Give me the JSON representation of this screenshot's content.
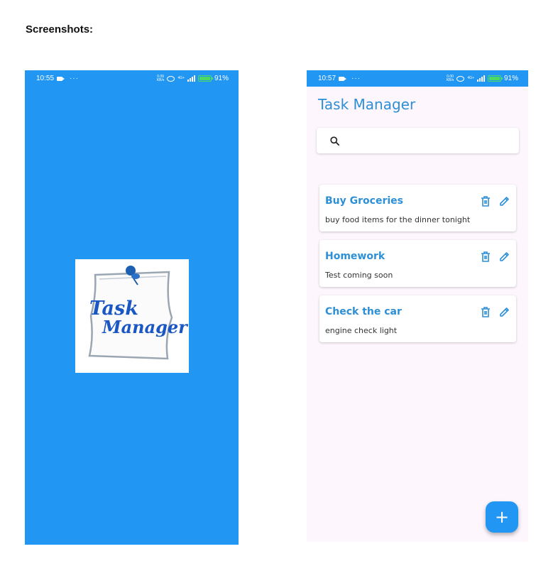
{
  "page": {
    "heading": "Screenshots:"
  },
  "splash": {
    "status": {
      "time": "10:55",
      "dots": "···",
      "speed_value": "0.09",
      "speed_unit": "KB/s",
      "network": "4G+",
      "battery": "91%"
    },
    "logo": {
      "line1": "Task",
      "line2": "Manager"
    },
    "colors": {
      "background": "#2196f3",
      "logo_text": "#1a56c4"
    }
  },
  "app": {
    "status": {
      "time": "10:57",
      "dots": "···",
      "speed_value": "0.00",
      "speed_unit": "KB/s",
      "network": "4G+",
      "battery": "91%"
    },
    "title": "Task Manager",
    "search": {
      "placeholder": "",
      "value": "",
      "icon": "search-icon"
    },
    "tasks": [
      {
        "title": "Buy Groceries",
        "description": "buy food items for the dinner tonight"
      },
      {
        "title": "Homework",
        "description": "Test coming soon"
      },
      {
        "title": "Check the car",
        "description": "engine check light"
      }
    ],
    "task_icons": [
      "delete-icon",
      "edit-icon"
    ],
    "fab_label": "+",
    "colors": {
      "accent": "#2196f3",
      "title": "#2d8fd6",
      "background": "#fdf6fd"
    }
  }
}
